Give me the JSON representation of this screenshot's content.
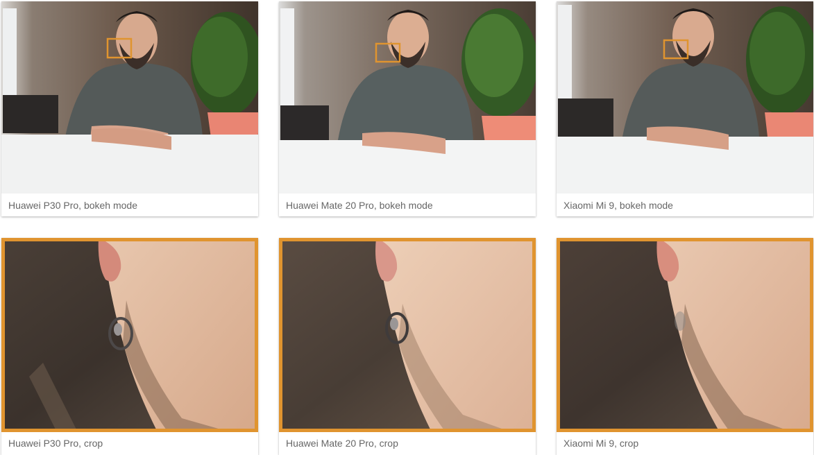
{
  "colors": {
    "accent": "#e0942f",
    "caption": "#666666"
  },
  "portraits": [
    {
      "caption": "Huawei P30 Pro, bokeh mode"
    },
    {
      "caption": "Huawei Mate 20 Pro, bokeh mode"
    },
    {
      "caption": "Xiaomi Mi 9, bokeh mode"
    }
  ],
  "crops": [
    {
      "caption": "Huawei P30 Pro, crop"
    },
    {
      "caption": "Huawei Mate 20 Pro, crop"
    },
    {
      "caption": "Xiaomi Mi 9, crop"
    }
  ]
}
